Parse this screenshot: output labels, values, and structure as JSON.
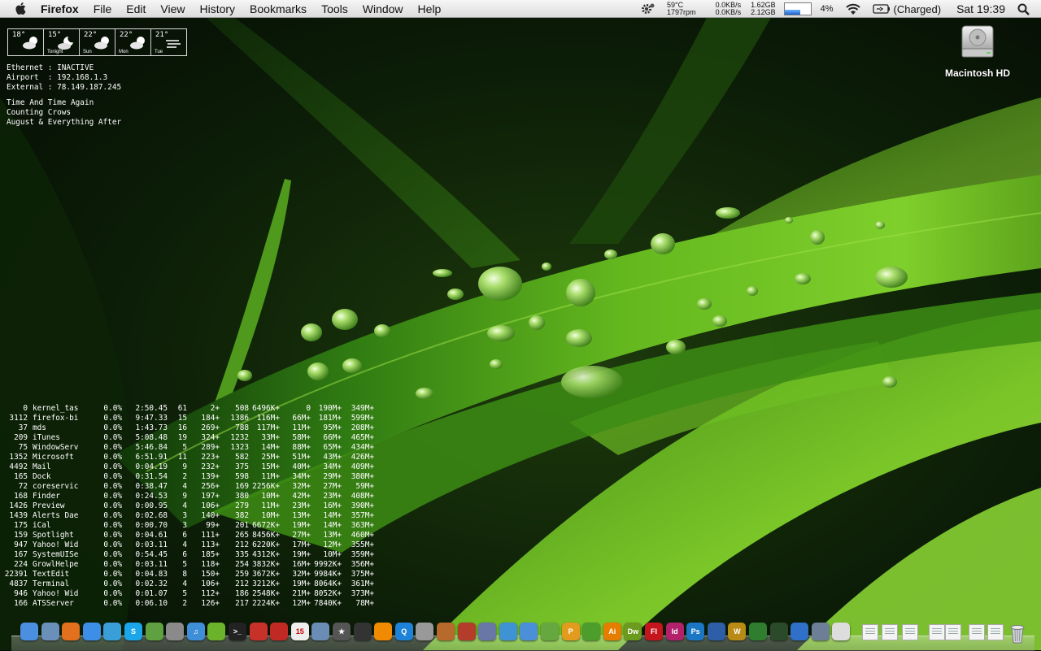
{
  "menubar": {
    "app_name": "Firefox",
    "menus": [
      "File",
      "Edit",
      "View",
      "History",
      "Bookmarks",
      "Tools",
      "Window",
      "Help"
    ],
    "status": {
      "temp": "59°C",
      "fan": "1797rpm",
      "net_up": "0.0KB/s",
      "net_down": "0.0KB/s",
      "mem_used": "1.62GB",
      "mem_free": "2.12GB",
      "cpu_percent": "4%",
      "battery": "(Charged)",
      "clock": "Sat 19:39"
    }
  },
  "weather": {
    "days": [
      {
        "temp": "18°",
        "label": "",
        "icon": "partly-sunny-icon"
      },
      {
        "temp": "15°",
        "label": "Tonight",
        "icon": "moon-cloud-icon"
      },
      {
        "temp": "22°",
        "label": "Sun",
        "icon": "partly-sunny-icon"
      },
      {
        "temp": "22°",
        "label": "Mon",
        "icon": "partly-sunny-icon"
      },
      {
        "temp": "21°",
        "label": "Tue",
        "icon": "wind-icon"
      }
    ]
  },
  "network": {
    "lines": [
      "Ethernet : INACTIVE",
      "Airport  : 192.168.1.3",
      "External : 78.149.187.245"
    ]
  },
  "itunes": {
    "lines": [
      "Time And Time Again",
      "Counting Crows",
      "August & Everything After"
    ]
  },
  "processes": [
    [
      "0",
      "kernel_tas",
      "0.0%",
      "2:50.45",
      "61",
      "2+",
      "508",
      "6496K+",
      "0",
      "190M+",
      "349M+"
    ],
    [
      "3112",
      "firefox-bi",
      "0.0%",
      "9:47.33",
      "15",
      "184+",
      "1386",
      "116M+",
      "66M+",
      "181M+",
      "599M+"
    ],
    [
      "37",
      "mds",
      "0.0%",
      "1:43.73",
      "16",
      "269+",
      "788",
      "117M+",
      "11M+",
      "95M+",
      "208M+"
    ],
    [
      "209",
      "iTunes",
      "0.0%",
      "5:08.48",
      "19",
      "324+",
      "1232",
      "33M+",
      "58M+",
      "66M+",
      "465M+"
    ],
    [
      "75",
      "WindowServ",
      "0.0%",
      "5:46.84",
      "5",
      "289+",
      "1323",
      "14M+",
      "88M+",
      "65M+",
      "434M+"
    ],
    [
      "1352",
      "Microsoft",
      "0.0%",
      "6:51.91",
      "11",
      "223+",
      "582",
      "25M+",
      "51M+",
      "43M+",
      "426M+"
    ],
    [
      "4492",
      "Mail",
      "0.0%",
      "0:04.19",
      "9",
      "232+",
      "375",
      "15M+",
      "40M+",
      "34M+",
      "409M+"
    ],
    [
      "165",
      "Dock",
      "0.0%",
      "0:31.54",
      "2",
      "139+",
      "598",
      "11M+",
      "34M+",
      "29M+",
      "380M+"
    ],
    [
      "72",
      "coreservic",
      "0.0%",
      "0:38.47",
      "4",
      "256+",
      "169",
      "2256K+",
      "32M+",
      "27M+",
      "59M+"
    ],
    [
      "168",
      "Finder",
      "0.0%",
      "0:24.53",
      "9",
      "197+",
      "380",
      "10M+",
      "42M+",
      "23M+",
      "408M+"
    ],
    [
      "1426",
      "Preview",
      "0.0%",
      "0:00.95",
      "4",
      "106+",
      "279",
      "11M+",
      "23M+",
      "16M+",
      "390M+"
    ],
    [
      "1439",
      "Alerts Dae",
      "0.0%",
      "0:02.68",
      "3",
      "140+",
      "382",
      "10M+",
      "13M+",
      "14M+",
      "357M+"
    ],
    [
      "175",
      "iCal",
      "0.0%",
      "0:00.70",
      "3",
      "99+",
      "201",
      "6672K+",
      "19M+",
      "14M+",
      "363M+"
    ],
    [
      "159",
      "Spotlight",
      "0.0%",
      "0:04.61",
      "6",
      "111+",
      "265",
      "8456K+",
      "27M+",
      "13M+",
      "460M+"
    ],
    [
      "947",
      "Yahoo! Wid",
      "0.0%",
      "0:03.11",
      "4",
      "113+",
      "212",
      "6220K+",
      "17M+",
      "12M+",
      "355M+"
    ],
    [
      "167",
      "SystemUISe",
      "0.0%",
      "0:54.45",
      "6",
      "185+",
      "335",
      "4312K+",
      "19M+",
      "10M+",
      "359M+"
    ],
    [
      "224",
      "GrowlHelpe",
      "0.0%",
      "0:03.11",
      "5",
      "118+",
      "254",
      "3832K+",
      "16M+",
      "9992K+",
      "356M+"
    ],
    [
      "22391",
      "TextEdit",
      "0.0%",
      "0:04.83",
      "8",
      "150+",
      "259",
      "3672K+",
      "32M+",
      "9984K+",
      "375M+"
    ],
    [
      "4837",
      "Terminal",
      "0.0%",
      "0:02.32",
      "4",
      "106+",
      "212",
      "3212K+",
      "19M+",
      "8064K+",
      "361M+"
    ],
    [
      "946",
      "Yahoo! Wid",
      "0.0%",
      "0:01.07",
      "5",
      "112+",
      "186",
      "2548K+",
      "21M+",
      "8052K+",
      "373M+"
    ],
    [
      "166",
      "ATSServer",
      "0.0%",
      "0:06.10",
      "2",
      "126+",
      "217",
      "2224K+",
      "12M+",
      "7840K+",
      "78M+"
    ]
  ],
  "desktop": {
    "hd_label": "Macintosh HD"
  },
  "dock": {
    "apps": [
      {
        "name": "finder-icon",
        "text": "",
        "color": "#4a8fe0"
      },
      {
        "name": "preview-icon",
        "text": "",
        "color": "#6a8fb8"
      },
      {
        "name": "firefox-icon",
        "text": "",
        "color": "#e2701c"
      },
      {
        "name": "safari-icon",
        "text": "",
        "color": "#3c8ee6"
      },
      {
        "name": "ichat-icon",
        "text": "",
        "color": "#3a9ed8"
      },
      {
        "name": "skype-icon",
        "text": "S",
        "color": "#1aa6e8"
      },
      {
        "name": "growl-icon",
        "text": "",
        "color": "#5fa140"
      },
      {
        "name": "automator-icon",
        "text": "",
        "color": "#8a8a8a"
      },
      {
        "name": "itunes-icon",
        "text": "♫",
        "color": "#3f8fd8"
      },
      {
        "name": "spotify-icon",
        "text": "",
        "color": "#6cb32c"
      },
      {
        "name": "terminal-icon",
        "text": ">_",
        "color": "#222222"
      },
      {
        "name": "parallels-icon",
        "text": "",
        "color": "#c8312a"
      },
      {
        "name": "red-app-icon",
        "text": "",
        "color": "#c12a24"
      },
      {
        "name": "ical-icon",
        "text": "15",
        "color": "#eeeeee"
      },
      {
        "name": "iphoto-icon",
        "text": "",
        "color": "#6b8db5"
      },
      {
        "name": "imovie-icon",
        "text": "★",
        "color": "#555555"
      },
      {
        "name": "clapper-icon",
        "text": "",
        "color": "#333333"
      },
      {
        "name": "vlc-icon",
        "text": "",
        "color": "#f08a00"
      },
      {
        "name": "quicktime-icon",
        "text": "Q",
        "color": "#1e82d8"
      },
      {
        "name": "system-preferences-icon",
        "text": "",
        "color": "#999999"
      },
      {
        "name": "guitar-icon",
        "text": "",
        "color": "#b86a2c"
      },
      {
        "name": "scripts-icon",
        "text": "",
        "color": "#b33d2a"
      },
      {
        "name": "pen-icon",
        "text": "",
        "color": "#6877a5"
      },
      {
        "name": "chart-app-icon",
        "text": "",
        "color": "#3f92d4"
      },
      {
        "name": "dashcode-icon",
        "text": "",
        "color": "#4a8fd8"
      },
      {
        "name": "hype-icon",
        "text": "",
        "color": "#66a83f"
      },
      {
        "name": "pages-icon",
        "text": "P",
        "color": "#e39b1e"
      },
      {
        "name": "xbox-icon",
        "text": "",
        "color": "#4c9d2c"
      },
      {
        "name": "illustrator-icon",
        "text": "Ai",
        "color": "#e57d00"
      },
      {
        "name": "dreamweaver-icon",
        "text": "Dw",
        "color": "#6c9a1f"
      },
      {
        "name": "flash-icon",
        "text": "Fl",
        "color": "#c4161c"
      },
      {
        "name": "indesign-icon",
        "text": "Id",
        "color": "#b3216b"
      },
      {
        "name": "photoshop-icon",
        "text": "Ps",
        "color": "#1b76c4"
      },
      {
        "name": "google-earth-icon",
        "text": "",
        "color": "#2e5ea8"
      },
      {
        "name": "warcraft-icon",
        "text": "W",
        "color": "#b88a16"
      },
      {
        "name": "game-icon",
        "text": "",
        "color": "#2f7d2f"
      },
      {
        "name": "plant-icon",
        "text": "",
        "color": "#2a4a2a"
      },
      {
        "name": "utility-icon",
        "text": "",
        "color": "#3070c8"
      },
      {
        "name": "preview-app-icon",
        "text": "",
        "color": "#6d7f96"
      },
      {
        "name": "textedit-icon",
        "text": "",
        "color": "#dddddd"
      }
    ],
    "docs_count_note": ""
  }
}
